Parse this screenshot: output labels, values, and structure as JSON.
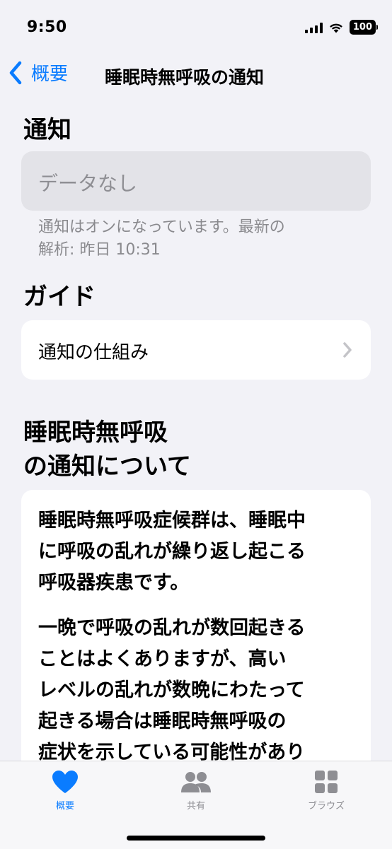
{
  "status": {
    "time": "9:50",
    "battery": "100"
  },
  "nav": {
    "back_label": "概要",
    "title": "睡眠時無呼吸の通知"
  },
  "notifications": {
    "heading": "通知",
    "empty_text": "データなし",
    "footnote_line1": "通知はオンになっています。最新の",
    "footnote_line2": "解析: 昨日 10:31"
  },
  "guide": {
    "heading": "ガイド",
    "item_label": "通知の仕組み"
  },
  "about": {
    "heading_line1": "睡眠時無呼吸",
    "heading_line2": "の通知について",
    "p1_lines": [
      "睡眠時無呼吸症候群は、睡眠中",
      "に呼吸の乱れが繰り返し起こる",
      "呼吸器疾患です。"
    ],
    "p2_lines": [
      "一晩で呼吸の乱れが数回起きる",
      "ことはよくありますが、高い",
      "レベルの乱れが数晩にわたって",
      "起きる場合は睡眠時無呼吸の",
      "症状を示している可能性があり"
    ]
  },
  "tabs": [
    {
      "label": "概要",
      "icon": "heart-icon",
      "selected": true
    },
    {
      "label": "共有",
      "icon": "people-icon",
      "selected": false
    },
    {
      "label": "ブラウズ",
      "icon": "grid-icon",
      "selected": false
    }
  ],
  "colors": {
    "accent": "#0a7cff",
    "inactive": "#8e8e93",
    "background": "#f2f2f7"
  }
}
